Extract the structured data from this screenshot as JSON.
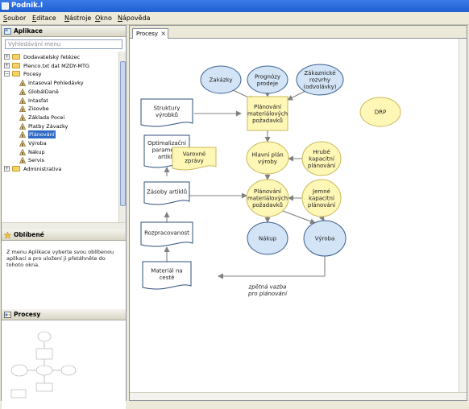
{
  "window": {
    "title": "Podnik.I"
  },
  "menu": [
    "Soubor",
    "Editace",
    "Nástroje",
    "Okno",
    "Nápověda"
  ],
  "sidebar": {
    "applications_title": "Aplikace",
    "search_placeholder": "Vyhledávání menu",
    "tree": [
      {
        "label": "Dodavatelský řetězec",
        "level": 0,
        "type": "folder",
        "expander": "+"
      },
      {
        "label": "Plenco.txt dat MZDY-MTG",
        "level": 0,
        "type": "folder",
        "expander": "+"
      },
      {
        "label": "Pocesy",
        "level": 0,
        "type": "folder",
        "expander": "−"
      },
      {
        "label": "Intasoval Pohledávky",
        "level": 1,
        "type": "process"
      },
      {
        "label": "GlobálDaně",
        "level": 1,
        "type": "process"
      },
      {
        "label": "Intasfat",
        "level": 1,
        "type": "process"
      },
      {
        "label": "Zisovbe",
        "level": 1,
        "type": "process"
      },
      {
        "label": "Základa Pocei",
        "level": 1,
        "type": "process"
      },
      {
        "label": "Platby Závazky",
        "level": 1,
        "type": "process"
      },
      {
        "label": "Plánování",
        "level": 1,
        "type": "process",
        "selected": true
      },
      {
        "label": "Výroba",
        "level": 1,
        "type": "process"
      },
      {
        "label": "Nákup",
        "level": 1,
        "type": "process"
      },
      {
        "label": "Servis",
        "level": 1,
        "type": "process"
      },
      {
        "label": "Administrativa",
        "level": 0,
        "type": "folder",
        "expander": "+"
      }
    ],
    "favorites_title": "Oblíbené",
    "favorites_text": "Z menu Aplikace vyberte svou oblíbenou aplikaci a pro uložení ji přetáhněte do tohoto okna.",
    "preview_title": "Procesy"
  },
  "tab": {
    "label": "Procesy",
    "close": "×"
  },
  "diagram": {
    "nodes": {
      "zakazky": "Zakázky",
      "prognozy": "Prognózy|prodeje",
      "zakaznicke": "Zákaznické|rozvrhy|(odvolávky)",
      "planovani_top": "Plánování|materiálových|požadavků",
      "drp": "DRP",
      "struktury": "Struktury|výrobků",
      "optimalizaci": "Optimalizační|parametry|artiklů",
      "varovne": "Varovné|zprávy",
      "hlavni_plan": "Hlavní plán|výroby",
      "hrube": "Hrubé|kapacitní|plánování",
      "zasoby": "Zásoby artiklů",
      "planovani_mid": "Plánování|materiálových|požadavků",
      "jemne": "Jemné|kapacitní|plánování",
      "rozpracovanost": "Rozpracovanost",
      "nakup": "Nákup",
      "vyroba": "Výroba",
      "material": "Materiál na|cestě",
      "zpetna": "zpětná vazba|pro plánování"
    }
  },
  "colors": {
    "yellow_fill": "#fff7b6",
    "yellow_stroke": "#c9b95a",
    "blue_fill": "#d2e4f6",
    "blue_stroke": "#3a5f8e",
    "arrow": "#808080",
    "titlebar": "#2d6ee0"
  }
}
